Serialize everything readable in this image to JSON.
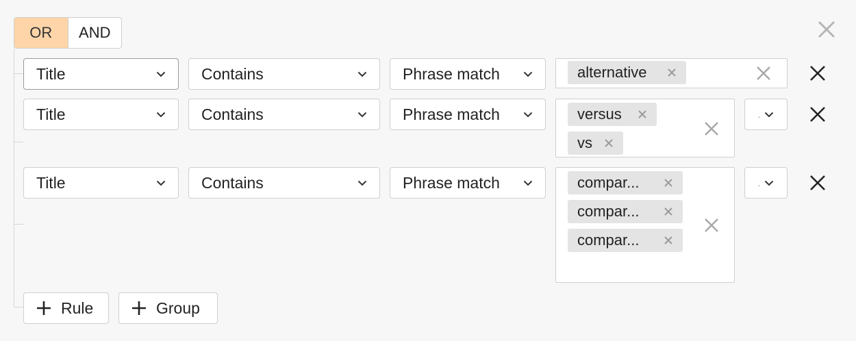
{
  "conjunction": {
    "options": [
      "OR",
      "AND"
    ],
    "selected": "OR"
  },
  "rules": [
    {
      "field": "Title",
      "operator": "Contains",
      "match_type": "Phrase match",
      "values": [
        "alternative"
      ],
      "extra_select": ""
    },
    {
      "field": "Title",
      "operator": "Contains",
      "match_type": "Phrase match",
      "values": [
        "versus",
        "vs"
      ],
      "extra_select": "."
    },
    {
      "field": "Title",
      "operator": "Contains",
      "match_type": "Phrase match",
      "values": [
        "compar...",
        "compar...",
        "compar..."
      ],
      "extra_select": "."
    }
  ],
  "actions": {
    "add_rule_label": "Rule",
    "add_group_label": "Group"
  },
  "icons": {
    "close_group": "close-icon",
    "chevron": "chevron-down-icon",
    "chip_remove": "close-icon",
    "clear_values": "close-icon",
    "remove_rule": "close-icon",
    "add": "plus-icon"
  },
  "colors": {
    "active_toggle": "#fdd5a8",
    "chip_background": "#e4e4e4",
    "border": "#cfcfcf",
    "page_background": "#f7f7f7"
  }
}
